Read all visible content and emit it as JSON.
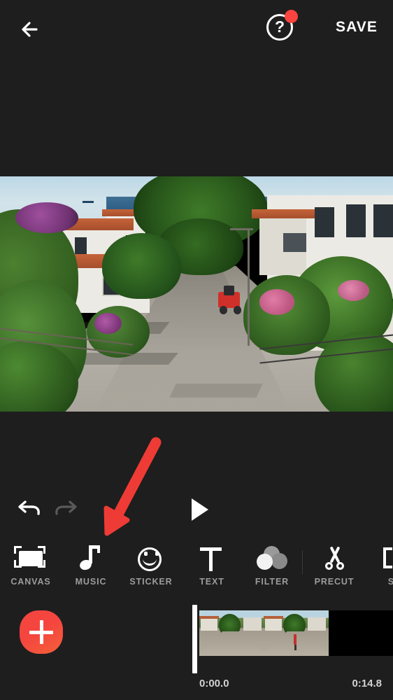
{
  "app": {
    "name": "video-editor",
    "background": "#1e1e1e",
    "accent": "#f4453f"
  },
  "topbar": {
    "back_icon": "back-arrow-icon",
    "help_icon": "help-question-icon",
    "help_badge": "notification-dot",
    "save_label": "SAVE"
  },
  "preview": {
    "description": "Sunny Mediterranean hillside street descending toward the sea, white houses with orange tile roofs, palms and flowering trees, a red motorbike parked at the roadside"
  },
  "controls": {
    "undo_icon": "undo-icon",
    "redo_icon": "redo-icon",
    "play_icon": "play-icon",
    "undo_enabled": "true",
    "redo_enabled": "false"
  },
  "toolbar": {
    "items": [
      {
        "label": "CANVAS",
        "icon": "canvas-frame-icon"
      },
      {
        "label": "MUSIC",
        "icon": "music-note-icon"
      },
      {
        "label": "STICKER",
        "icon": "smiley-face-icon"
      },
      {
        "label": "TEXT",
        "icon": "text-t-icon"
      },
      {
        "label": "FILTER",
        "icon": "filter-circles-icon"
      },
      {
        "label": "PRECUT",
        "icon": "scissors-icon"
      },
      {
        "label": "SP",
        "icon": "split-brackets-icon"
      }
    ]
  },
  "timeline": {
    "add_button_icon": "plus-icon",
    "playhead": "playhead-marker",
    "start_time": "0:00.0",
    "end_time": "0:14.8"
  },
  "annotation": {
    "arrow_color": "#ee3b35",
    "points_at": "MUSIC"
  }
}
